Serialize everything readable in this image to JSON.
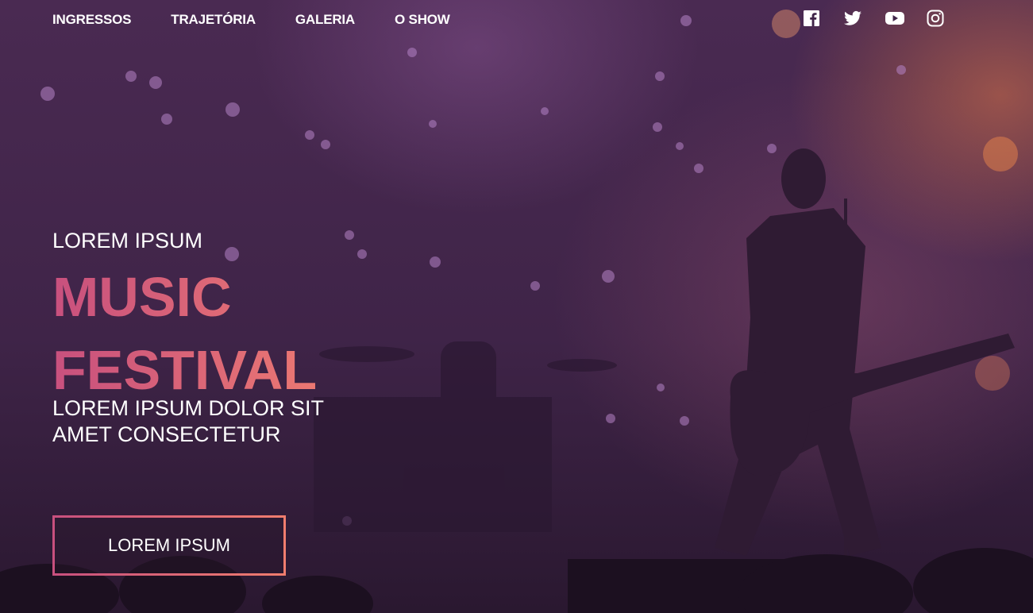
{
  "nav": {
    "items": [
      {
        "label": "INGRESSOS"
      },
      {
        "label": "TRAJETÓRIA"
      },
      {
        "label": "GALERIA"
      },
      {
        "label": "O SHOW"
      }
    ]
  },
  "social": {
    "icons": [
      "facebook-icon",
      "twitter-icon",
      "youtube-icon",
      "instagram-icon"
    ]
  },
  "hero": {
    "eyebrow": "LOREM IPSUM",
    "title_line1": "MUSIC",
    "title_line2": "FESTIVAL",
    "subtitle": "LOREM IPSUM DOLOR SIT AMET CONSECTETUR",
    "cta_label": "LOREM IPSUM"
  },
  "colors": {
    "title_gradient_start": "#c8507e",
    "title_gradient_end": "#ee7b71",
    "background": "#3f2448",
    "stage_light": "#de7648"
  }
}
